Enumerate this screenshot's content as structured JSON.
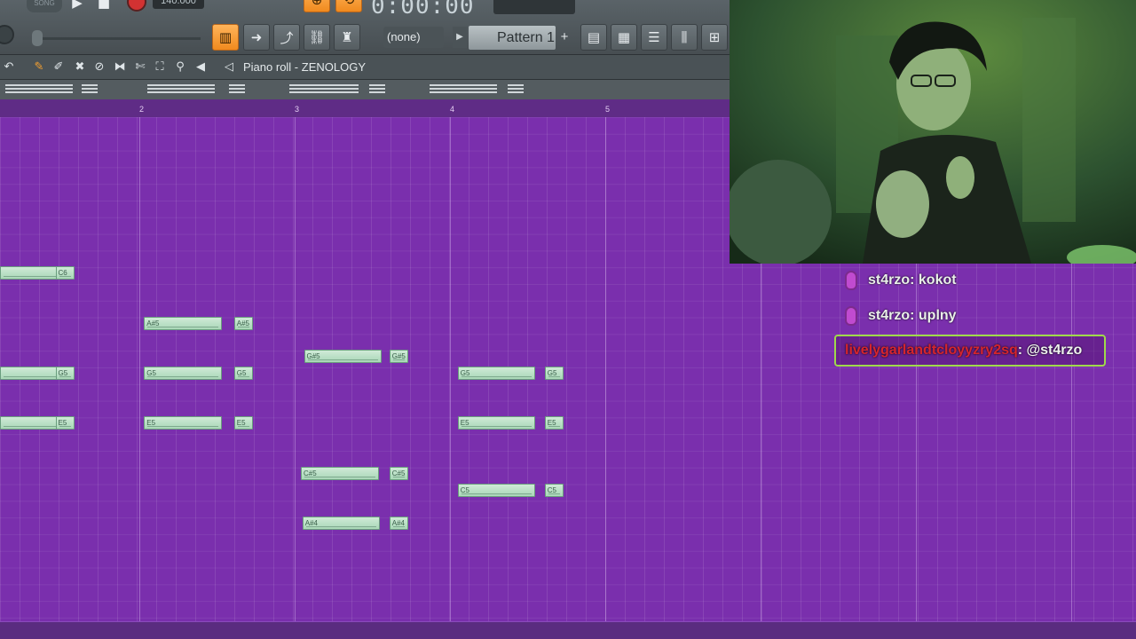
{
  "topbar": {
    "song_mode": "SONG",
    "tempo": "140.000",
    "time": "0:00:00",
    "snap": "(none)",
    "pattern": "Pattern 1",
    "pattern_add": "+"
  },
  "piano_roll": {
    "title": "Piano roll - ZENOLOGY",
    "bar_numbers": [
      "2",
      "3",
      "4",
      "5"
    ],
    "notes": [
      {
        "label": "",
        "bar": 1.09,
        "len": 0.4,
        "row": 9
      },
      {
        "label": "C6",
        "bar": 1.46,
        "len": 0.12,
        "row": 9
      },
      {
        "label": "A#5",
        "bar": 2.03,
        "len": 0.5,
        "row": 12
      },
      {
        "label": "A#5",
        "bar": 2.61,
        "len": 0.12,
        "row": 12
      },
      {
        "label": "G#5",
        "bar": 3.06,
        "len": 0.5,
        "row": 14
      },
      {
        "label": "G#5",
        "bar": 3.61,
        "len": 0.12,
        "row": 14
      },
      {
        "label": "",
        "bar": 1.09,
        "len": 0.4,
        "row": 15
      },
      {
        "label": "G5",
        "bar": 1.46,
        "len": 0.12,
        "row": 15
      },
      {
        "label": "G5",
        "bar": 2.03,
        "len": 0.5,
        "row": 15
      },
      {
        "label": "G5",
        "bar": 2.61,
        "len": 0.12,
        "row": 15
      },
      {
        "label": "G5",
        "bar": 4.05,
        "len": 0.5,
        "row": 15
      },
      {
        "label": "G5",
        "bar": 4.61,
        "len": 0.12,
        "row": 15
      },
      {
        "label": "",
        "bar": 1.09,
        "len": 0.4,
        "row": 18
      },
      {
        "label": "E5",
        "bar": 1.46,
        "len": 0.12,
        "row": 18
      },
      {
        "label": "E5",
        "bar": 2.03,
        "len": 0.5,
        "row": 18
      },
      {
        "label": "E5",
        "bar": 2.61,
        "len": 0.12,
        "row": 18
      },
      {
        "label": "E5",
        "bar": 4.05,
        "len": 0.5,
        "row": 18
      },
      {
        "label": "E5",
        "bar": 4.61,
        "len": 0.12,
        "row": 18
      },
      {
        "label": "C#5",
        "bar": 3.04,
        "len": 0.5,
        "row": 21
      },
      {
        "label": "C#5",
        "bar": 3.61,
        "len": 0.12,
        "row": 21
      },
      {
        "label": "C5",
        "bar": 4.05,
        "len": 0.5,
        "row": 22
      },
      {
        "label": "C5",
        "bar": 4.61,
        "len": 0.12,
        "row": 22
      },
      {
        "label": "A#4",
        "bar": 3.05,
        "len": 0.5,
        "row": 24
      },
      {
        "label": "A#4",
        "bar": 3.61,
        "len": 0.12,
        "row": 24
      }
    ]
  },
  "chat": {
    "messages": [
      {
        "user": "st4rzo",
        "text": "kokot"
      },
      {
        "user": "st4rzo",
        "text": "uplny"
      }
    ],
    "highlight": {
      "user": "livelygarlandtcloyyzry2sq",
      "text": ": @st4rzo"
    }
  },
  "colors": {
    "grid": "#7a2fad",
    "note": "#bfe3ca",
    "accent": "#f08a1e",
    "highlight_border": "#9fd94a"
  }
}
